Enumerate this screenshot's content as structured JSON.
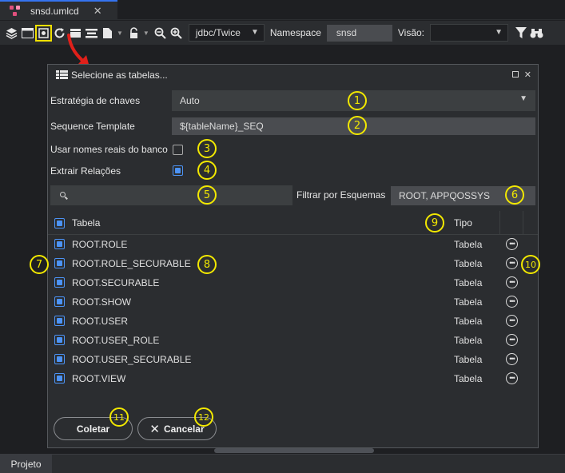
{
  "tab": {
    "title": "snsd.umlcd",
    "close": "✕"
  },
  "toolbar": {
    "connection": "jdbc/Twice",
    "namespace_label": "Namespace",
    "namespace_value": "snsd",
    "visao_label": "Visão:",
    "visao_value": ""
  },
  "dialog": {
    "title": "Selecione as tabelas...",
    "estrategia": {
      "label": "Estratégia de chaves",
      "value": "Auto"
    },
    "sequence": {
      "label": "Sequence Template",
      "value": "${tableName}_SEQ"
    },
    "usar_nomes": {
      "label": "Usar nomes reais do banco",
      "checked": false
    },
    "extrair": {
      "label": "Extrair Relações",
      "checked": true
    },
    "search": {
      "value": ""
    },
    "filtro": {
      "label": "Filtrar por Esquemas",
      "value": "ROOT,  APPQOSSYS"
    },
    "table": {
      "header_tabela": "Tabela",
      "header_tipo": "Tipo",
      "rows": [
        {
          "name": "ROOT.ROLE",
          "tipo": "Tabela",
          "checked": true
        },
        {
          "name": "ROOT.ROLE_SECURABLE",
          "tipo": "Tabela",
          "checked": true
        },
        {
          "name": "ROOT.SECURABLE",
          "tipo": "Tabela",
          "checked": true
        },
        {
          "name": "ROOT.SHOW",
          "tipo": "Tabela",
          "checked": true
        },
        {
          "name": "ROOT.USER",
          "tipo": "Tabela",
          "checked": true
        },
        {
          "name": "ROOT.USER_ROLE",
          "tipo": "Tabela",
          "checked": true
        },
        {
          "name": "ROOT.USER_SECURABLE",
          "tipo": "Tabela",
          "checked": true
        },
        {
          "name": "ROOT.VIEW",
          "tipo": "Tabela",
          "checked": true
        }
      ]
    },
    "coletar": "Coletar",
    "cancelar": "Cancelar"
  },
  "callouts": [
    "1",
    "2",
    "3",
    "4",
    "5",
    "6",
    "7",
    "8",
    "9",
    "10",
    "11",
    "12"
  ],
  "bottom": {
    "projeto": "Projeto"
  },
  "colors": {
    "accent": "#4c93f5",
    "annotation": "#f2e800",
    "arrow": "#e0201a"
  }
}
